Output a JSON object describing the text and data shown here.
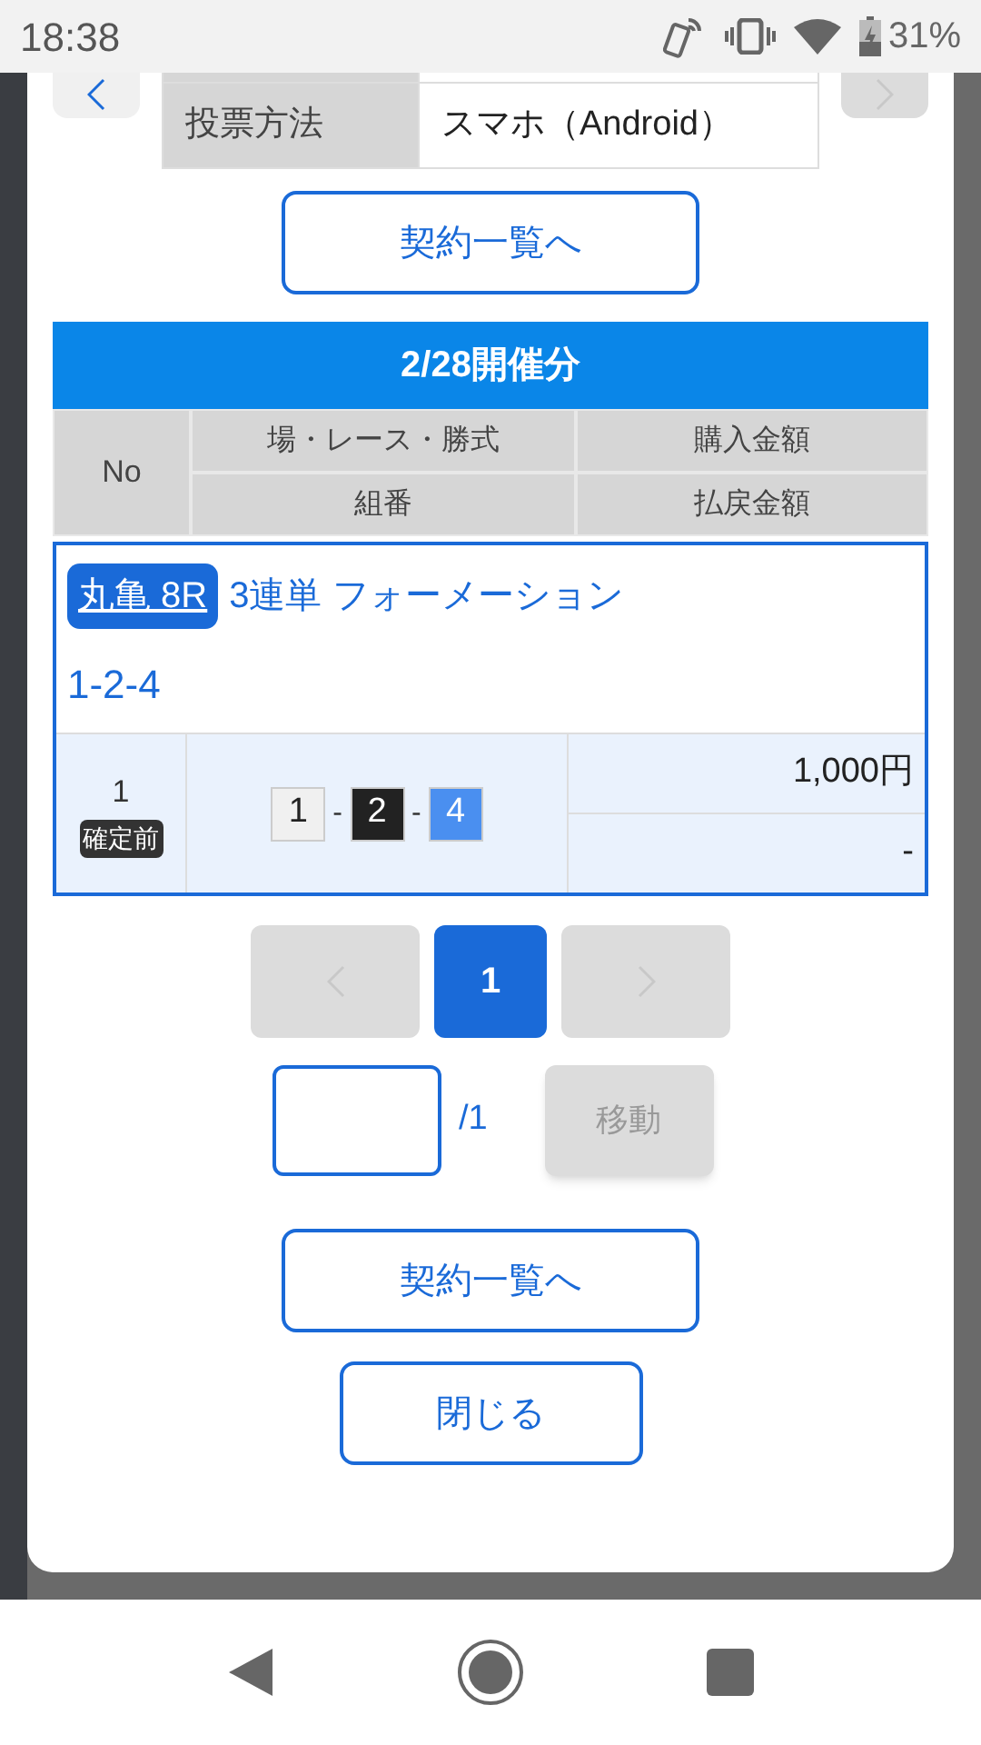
{
  "status_bar": {
    "time": "18:38",
    "battery": "31%"
  },
  "top_nav": {
    "prev": {
      "disabled": false
    },
    "next": {
      "disabled": true
    }
  },
  "info_table": {
    "rows": [
      {
        "label": "投票方法",
        "value": "スマホ（Android）"
      }
    ]
  },
  "list_button_top": "契約一覧へ",
  "section": {
    "title": "2/28開催分",
    "columns": [
      "No",
      "場・レース・勝式",
      "購入金額",
      "組番",
      "払戻金額"
    ],
    "entries": [
      {
        "venue_race": "丸亀 8R",
        "bet_type": "3連単 フォーメーション",
        "combination": "1-2-4",
        "no": "1",
        "status": "確定前",
        "boats": [
          {
            "text": "1",
            "color": "#f0f0f0"
          },
          {
            "text": "-",
            "kind": "separator"
          },
          {
            "text": "2",
            "color": "#222222"
          },
          {
            "text": "-",
            "kind": "separator"
          },
          {
            "text": "4",
            "color": "#4a8ff0"
          }
        ],
        "purchase": "1,000円",
        "payout": "-"
      }
    ]
  },
  "pagination": {
    "prev": {
      "disabled": true
    },
    "pages": [
      {
        "label": "1",
        "selected": true
      }
    ],
    "next": {
      "disabled": true
    }
  },
  "page_jump": {
    "total": "/1",
    "button": "移動",
    "disabled": true
  },
  "buttons": [
    "契約一覧へ",
    "閉じる"
  ]
}
